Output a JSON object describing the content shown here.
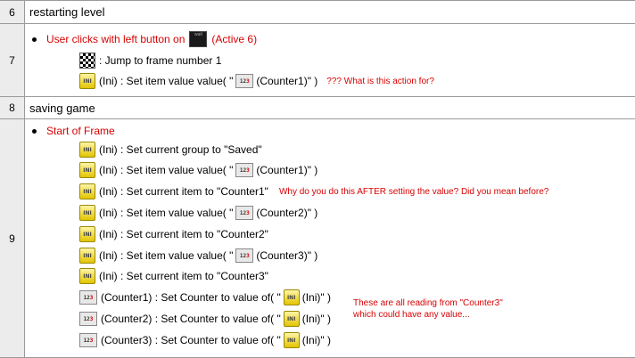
{
  "rows": [
    {
      "num": "6",
      "title": "restarting level"
    },
    {
      "num": "7"
    },
    {
      "num": "8",
      "title": "saving game"
    },
    {
      "num": "9"
    }
  ],
  "event7": {
    "bullet_prefix": "User clicks with left button on",
    "bullet_suffix": "(Active 6)",
    "active_icon_label": "wait",
    "actions": [
      {
        "object": "",
        "text": ": Jump to frame number 1"
      },
      {
        "object": "(Ini)",
        "pre": ": Set item value value( \"",
        "post": "(Counter1)\" )"
      }
    ],
    "comment": "??? What is this action for?"
  },
  "event9": {
    "condition": "Start of Frame",
    "actions": [
      {
        "object": "(Ini)",
        "text": ": Set current group to \"Saved\""
      },
      {
        "object": "(Ini)",
        "pre": ": Set item value value( \"",
        "post": "(Counter1)\" )"
      },
      {
        "object": "(Ini)",
        "text": ": Set current item to \"Counter1\""
      },
      {
        "object": "(Ini)",
        "pre": ": Set item value value( \"",
        "post": "(Counter2)\" )"
      },
      {
        "object": "(Ini)",
        "text": ": Set current item to \"Counter2\""
      },
      {
        "object": "(Ini)",
        "pre": ": Set item value value( \"",
        "post": "(Counter3)\" )"
      },
      {
        "object": "(Ini)",
        "text": ": Set current item to \"Counter3\""
      },
      {
        "object": "(Counter1)",
        "pre": ": Set Counter to value of( \"",
        "post": "(Ini)\" )"
      },
      {
        "object": "(Counter2)",
        "pre": ": Set Counter to value of( \"",
        "post": "(Ini)\" )"
      },
      {
        "object": "(Counter3)",
        "pre": ": Set Counter to value of( \"",
        "post": "(Ini)\" )"
      }
    ],
    "comment_after": "Why do you do this AFTER setting the value? Did you mean before?",
    "comment_reading": "These are all reading from \"Counter3\" which could have any value..."
  },
  "icons": {
    "ini_label": "INI",
    "counter_label_a": "12",
    "counter_label_b": "3"
  },
  "colors": {
    "comment": "#d80000",
    "row_number_bg": "#ececec",
    "grid": "#9a9a9a"
  }
}
